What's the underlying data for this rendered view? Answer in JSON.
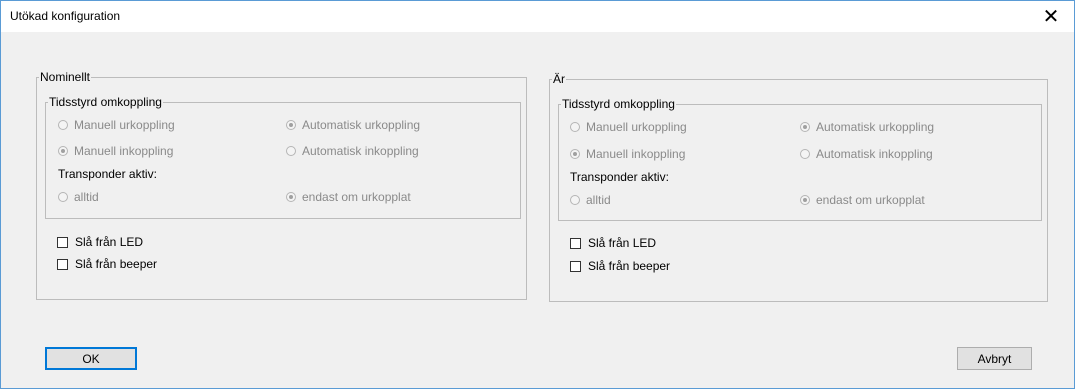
{
  "window": {
    "title": "Utökad konfiguration",
    "close_glyph": "✕"
  },
  "panels": [
    {
      "legend": "Nominellt",
      "group_legend": "Tidsstyrd omkoppling",
      "radio_manuell_urkoppling": {
        "label": "Manuell urkoppling",
        "checked": false
      },
      "radio_automatisk_urkoppling": {
        "label": "Automatisk urkoppling",
        "checked": true
      },
      "radio_manuell_inkoppling": {
        "label": "Manuell inkoppling",
        "checked": true
      },
      "radio_automatisk_inkoppling": {
        "label": "Automatisk inkoppling",
        "checked": false
      },
      "transponder_label": "Transponder aktiv:",
      "radio_alltid": {
        "label": "alltid",
        "checked": false
      },
      "radio_endast": {
        "label": "endast om urkopplat",
        "checked": true
      },
      "cb_led": {
        "label": "Slå från LED",
        "checked": false
      },
      "cb_beeper": {
        "label": "Slå från beeper",
        "checked": false
      }
    },
    {
      "legend": "Är",
      "group_legend": "Tidsstyrd omkoppling",
      "radio_manuell_urkoppling": {
        "label": "Manuell urkoppling",
        "checked": false
      },
      "radio_automatisk_urkoppling": {
        "label": "Automatisk urkoppling",
        "checked": true
      },
      "radio_manuell_inkoppling": {
        "label": "Manuell inkoppling",
        "checked": true
      },
      "radio_automatisk_inkoppling": {
        "label": "Automatisk inkoppling",
        "checked": false
      },
      "transponder_label": "Transponder aktiv:",
      "radio_alltid": {
        "label": "alltid",
        "checked": false
      },
      "radio_endast": {
        "label": "endast om urkopplat",
        "checked": true
      },
      "cb_led": {
        "label": "Slå från LED",
        "checked": false
      },
      "cb_beeper": {
        "label": "Slå från beeper",
        "checked": false
      }
    }
  ],
  "buttons": {
    "ok": "OK",
    "cancel": "Avbryt"
  },
  "colors": {
    "window_border": "#5a9bd5",
    "disabled_text": "#8a8a8a",
    "default_button_border": "#0078d7"
  }
}
